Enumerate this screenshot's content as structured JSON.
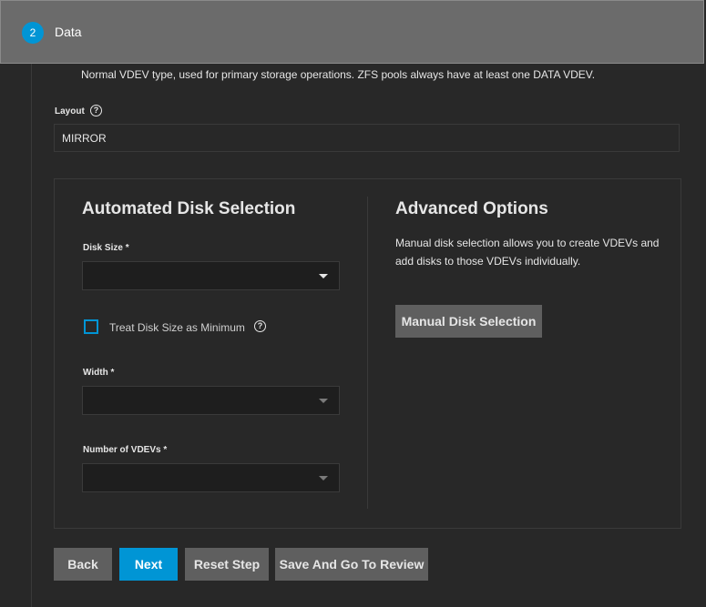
{
  "step": {
    "number": "2",
    "title": "Data"
  },
  "vdev_description": "Normal VDEV type, used for primary storage operations. ZFS pools always have at least one DATA VDEV.",
  "layout": {
    "label": "Layout",
    "value": "MIRROR",
    "help_icon": "?"
  },
  "automated": {
    "title": "Automated Disk Selection",
    "disk_size_label": "Disk Size *",
    "disk_size_value": "",
    "treat_min_label": "Treat Disk Size as Minimum",
    "treat_min_checked": false,
    "help_icon": "?",
    "width_label": "Width *",
    "width_value": "",
    "num_vdevs_label": "Number of VDEVs *",
    "num_vdevs_value": ""
  },
  "advanced": {
    "title": "Advanced Options",
    "description": "Manual disk selection allows you to create VDEVs and add disks to those VDEVs individually.",
    "manual_button": "Manual Disk Selection"
  },
  "footer": {
    "back": "Back",
    "next": "Next",
    "reset": "Reset Step",
    "review": "Save And Go To Review"
  },
  "colors": {
    "accent": "#0095d5",
    "background": "#282828",
    "header": "#6b6b6b",
    "button": "#5f5f5f"
  }
}
